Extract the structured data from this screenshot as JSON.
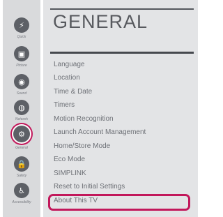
{
  "sidebar": {
    "items": [
      {
        "label": "Quick",
        "icon": "lightning-icon",
        "glyph": "⚡"
      },
      {
        "label": "Picture",
        "icon": "picture-icon",
        "glyph": "▣"
      },
      {
        "label": "Sound",
        "icon": "sound-icon",
        "glyph": "◉"
      },
      {
        "label": "Network",
        "icon": "network-icon",
        "glyph": "◍"
      },
      {
        "label": "General",
        "icon": "general-icon",
        "glyph": "⚙"
      },
      {
        "label": "Safety",
        "icon": "lock-icon",
        "glyph": "🔒"
      },
      {
        "label": "Accessibility",
        "icon": "accessibility-icon",
        "glyph": "♿"
      }
    ],
    "selected": "General"
  },
  "header": {
    "title": "GENERAL"
  },
  "menu": {
    "items": [
      "Language",
      "Location",
      "Time & Date",
      "Timers",
      "Motion Recognition",
      "Launch Account Management",
      "Home/Store Mode",
      "Eco Mode",
      "SIMPLINK",
      "Reset to Initial Settings",
      "About This TV"
    ],
    "highlighted": "About This TV"
  },
  "colors": {
    "accent": "#c2185b",
    "panel": "#e3e4e6",
    "sidebar": "#d9dadc"
  }
}
